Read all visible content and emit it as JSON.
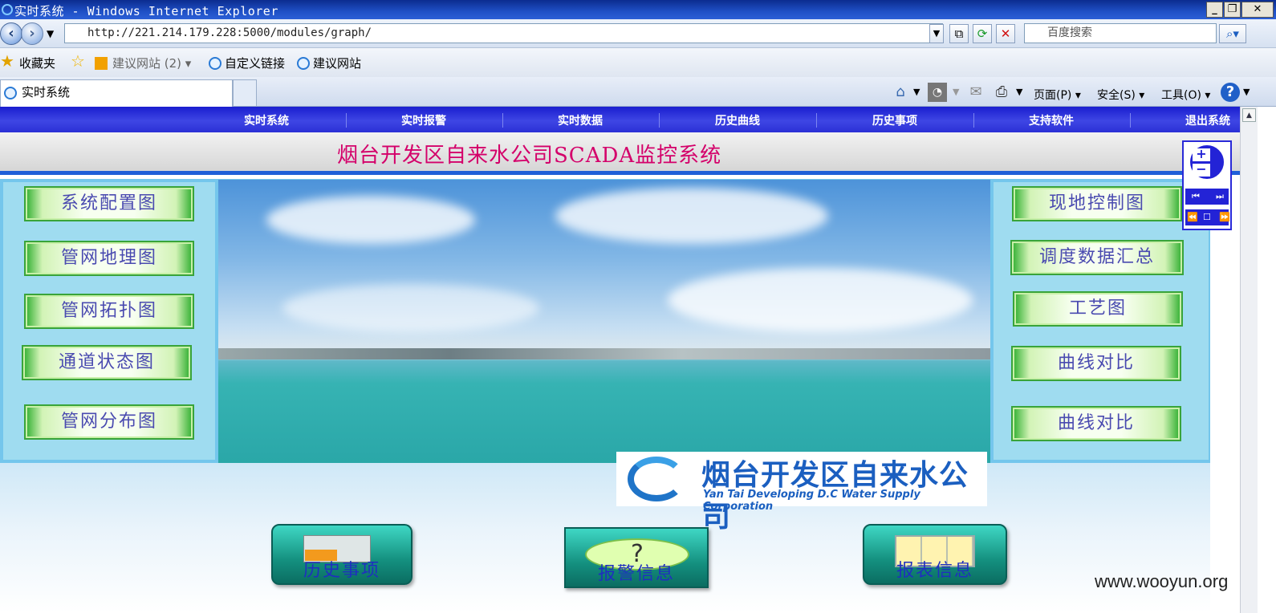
{
  "window": {
    "title": "实时系统 - Windows Internet Explorer",
    "controls": [
      "_",
      "❐",
      "✕"
    ]
  },
  "address": {
    "url": "http://221.214.179.228:5000/modules/graph/",
    "search_placeholder": "百度搜索"
  },
  "favorites": {
    "label": "收藏夹",
    "items": [
      "建议网站 (2)",
      "自定义链接",
      "建议网站"
    ]
  },
  "tab": {
    "title": "实时系统"
  },
  "commandbar": {
    "page": "页面(P)",
    "safety": "安全(S)",
    "tools": "工具(O)"
  },
  "nav": {
    "items": [
      "实时系统",
      "实时报警",
      "实时数据",
      "历史曲线",
      "历史事项",
      "支持软件",
      "退出系统"
    ]
  },
  "header": {
    "title": "烟台开发区自来水公司SCADA监控系统"
  },
  "left_buttons": [
    "系统配置图",
    "管网地理图",
    "管网拓扑图",
    "通道状态图",
    "管网分布图"
  ],
  "right_buttons": [
    "现地控制图",
    "调度数据汇总",
    "工艺图",
    "曲线对比",
    "曲线对比"
  ],
  "company": {
    "name_cn": "烟台开发区自来水公司",
    "name_en": "Yan Tai Developing D.C Water Supply Corporation"
  },
  "bottom_buttons": [
    "历史事项",
    "报警信息",
    "报表信息"
  ],
  "zoom": {
    "plus": "+",
    "minus": "−"
  },
  "watermark": "www.wooyun.org"
}
